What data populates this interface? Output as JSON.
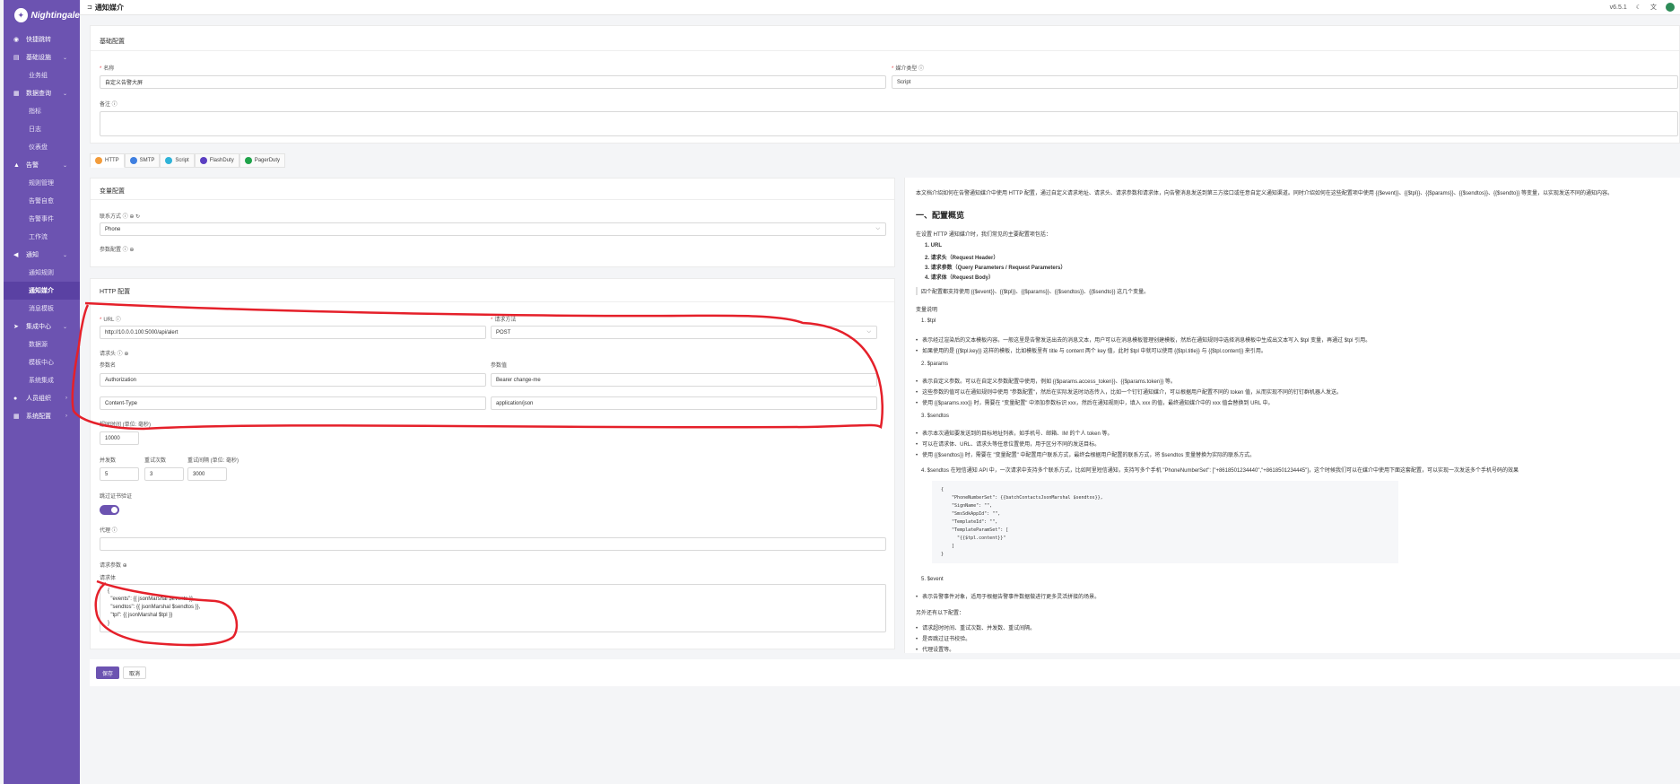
{
  "app": {
    "name": "Nightingale",
    "version": "v6.5.1"
  },
  "header": {
    "title": "通知媒介"
  },
  "sidebar": {
    "items": [
      {
        "label": "快捷跳转",
        "icon": "eye-icon",
        "type": "group"
      },
      {
        "label": "基础设施",
        "icon": "server-icon",
        "type": "group",
        "chevron": "⌄"
      },
      {
        "label": "业务组",
        "type": "sub"
      },
      {
        "label": "数据查询",
        "icon": "database-icon",
        "type": "group",
        "chevron": "⌄"
      },
      {
        "label": "指标",
        "type": "sub"
      },
      {
        "label": "日志",
        "type": "sub"
      },
      {
        "label": "仪表盘",
        "type": "sub"
      },
      {
        "label": "告警",
        "icon": "alert-icon",
        "type": "group",
        "chevron": "⌄"
      },
      {
        "label": "规则管理",
        "type": "sub"
      },
      {
        "label": "告警自愈",
        "type": "sub"
      },
      {
        "label": "告警事件",
        "type": "sub"
      },
      {
        "label": "工作流",
        "type": "sub"
      },
      {
        "label": "通知",
        "icon": "bell-icon",
        "type": "group",
        "chevron": "⌄"
      },
      {
        "label": "通知规则",
        "type": "sub"
      },
      {
        "label": "通知媒介",
        "type": "sub",
        "active": true
      },
      {
        "label": "消息模板",
        "type": "sub"
      },
      {
        "label": "集成中心",
        "icon": "rocket-icon",
        "type": "group",
        "chevron": "⌄"
      },
      {
        "label": "数据源",
        "type": "sub"
      },
      {
        "label": "模板中心",
        "type": "sub"
      },
      {
        "label": "系统集成",
        "type": "sub"
      },
      {
        "label": "人员组织",
        "icon": "user-icon",
        "type": "group",
        "chevron": "›"
      },
      {
        "label": "系统配置",
        "icon": "grid-icon",
        "type": "group",
        "chevron": "›"
      }
    ]
  },
  "basic": {
    "title": "基础配置",
    "name_label": "名称",
    "name_value": "自定义告警大屏",
    "type_label": "媒介类型",
    "type_value": "Script",
    "note_label": "备注"
  },
  "tabs": [
    {
      "label": "HTTP",
      "color": "#f39c3b"
    },
    {
      "label": "SMTP",
      "color": "#3f7fe0"
    },
    {
      "label": "Script",
      "color": "#2fb3d8"
    },
    {
      "label": "FlashDuty",
      "color": "#5b3fc2"
    },
    {
      "label": "PagerDuty",
      "color": "#1fa34a"
    }
  ],
  "variables": {
    "title": "变量配置",
    "contact_label": "联系方式",
    "contact_value": "Phone",
    "param_label": "参数配置"
  },
  "http": {
    "title": "HTTP 配置",
    "url_label": "URL",
    "url_value": "http://10.0.0.100:5000/api/alert",
    "method_label": "请求方法",
    "method_value": "POST",
    "headers_label": "请求头",
    "param_name_label": "参数名",
    "param_value_label": "参数值",
    "headers": [
      {
        "name": "Authorization",
        "value": "Bearer change-me"
      },
      {
        "name": "Content-Type",
        "value": "application/json"
      }
    ],
    "timeout_label": "超时时间 (单位: 毫秒)",
    "timeout_value": "10000",
    "concurrency_label": "并发数",
    "concurrency_value": "5",
    "retry_label": "重试次数",
    "retry_value": "3",
    "retry_interval_label": "重试间隔 (单位: 毫秒)",
    "retry_interval_value": "3000",
    "skip_tls_label": "跳过证书验证",
    "proxy_label": "代理",
    "req_params_label": "请求参数",
    "body_label": "请求体",
    "body_lines": [
      "{",
      "  \"events\": {{ jsonMarshal $events }},",
      "  \"sendtos\": {{ jsonMarshal $sendtos }},",
      "  \"tpl\": {{ jsonMarshal $tpl }}",
      "}"
    ]
  },
  "actions": {
    "save": "保存",
    "cancel": "取消"
  },
  "doc": {
    "intro": "本文档介绍如何在告警通知媒介中使用 HTTP 配置，通过自定义请求地址、请求头、请求参数和请求体，向告警消息发送到第三方接口或任意自定义通知渠道。同时介绍如何在这些配置项中使用 {{$event}}、{{$tpl}}、{{$params}}、{{$sendtos}}、{{$sendto}} 等变量，以实现发送不同的通知内容。",
    "h1": "一、配置概览",
    "overview": "在设置 HTTP 通知媒介时，我们常见的主要配置项包括：",
    "list": [
      "1. URL",
      "2. 请求头（Request Header）",
      "3. 请求参数（Query Parameters / Request Parameters）",
      "4. 请求体（Request Body）"
    ],
    "quote": "四个配置都支持使用 {{$event}}、{{$tpl}}、{{$params}}、{{$sendtos}}、{{$sendto}} 这几个变量。",
    "var_title": "变量说明",
    "tpl_title": "1. $tpl",
    "tpl_b1": "表示经过渲染后的文本模板内容。一般这里是告警发送出去的消息文本，用户可以在消息模板管理创建模板，然后在通知规则中选择消息模板中生成出文本写入 $tpl 变量，再通过 $tpl 引用。",
    "tpl_b2": "如果使用的是 {{$tpl.key}} 这样的模板，比如模板里有 title 与 content 两个 key 值，此时 $tpl 中就可以使用 {{$tpl.title}} 与 {{$tpl.content}} 来引用。",
    "params_title": "2. $params",
    "params_b1": "表示自定义参数。可以在自定义参数配置中使用，例如 {{$params.access_token}}、{{$params.token}} 等。",
    "params_b2": "这些参数的值可以在通知规则中使用 \"参数配置\"，然后在实际发送时动态传入，比如一个钉钉通知媒介，可以根据用户配置不同的 token 值，从而实现不同的钉钉群机器人发送。",
    "params_b3": "使用 {{$params.xxx}} 时，需要在 \"变量配置\" 中添加参数标识 xxx，然后在通知规则中，填入 xxx 的值，最终通知媒介中的 xxx 值会替换到 URL 中。",
    "sendtos_title": "3. $sendtos",
    "sendtos_b1": "表示本次通知要发送到的目标地址列表，如手机号、邮箱、IM 的个人 token 等。",
    "sendtos_b2": "可以在请求体、URL、请求头等任意位置使用，用于区分不同的发送目标。",
    "sendtos_b3": "使用 {{$sendtos}} 时，需要在 \"变量配置\" 中配置用户联系方式，最终会根据用户配置的联系方式，将 $sendtos 变量替换为实际的联系方式。",
    "sendtos_4": "4. $sendtos 在短信通知 API 中，一次请求中支持多个联系方式，比如阿里短信通知，支持写多个手机 \"PhoneNumberSet\": [\"+8618501234440\",\"+8618501234445\"]，这个时候我们可以在媒介中使用下面这套配置，可以实现一次发送多个手机号码的效果",
    "code_lines": [
      "{",
      "    \"PhoneNumberSet\": {{batchContactsJsonMarshal $sendtos}},",
      "    \"SignName\": \"\",",
      "    \"SmsSdkAppId\": \"\",",
      "    \"TemplateId\": \"\",",
      "    \"TemplateParamSet\": [",
      "      \"{{$tpl.content}}\"",
      "    ]",
      "}"
    ],
    "event_title": "5. $event",
    "event_b1": "表示告警事件对象，适用于根据告警事件数据做进行更多灵活拼接的场景。",
    "other_title": "另外还有以下配置：",
    "other_b1": "请求超时时间、重试次数、并发数、重试间隔。",
    "other_b2": "是否跳过证书校验。",
    "other_b3": "代理设置等。"
  },
  "colors": {
    "primary": "#6c53b1",
    "annotation": "#e5202a"
  }
}
